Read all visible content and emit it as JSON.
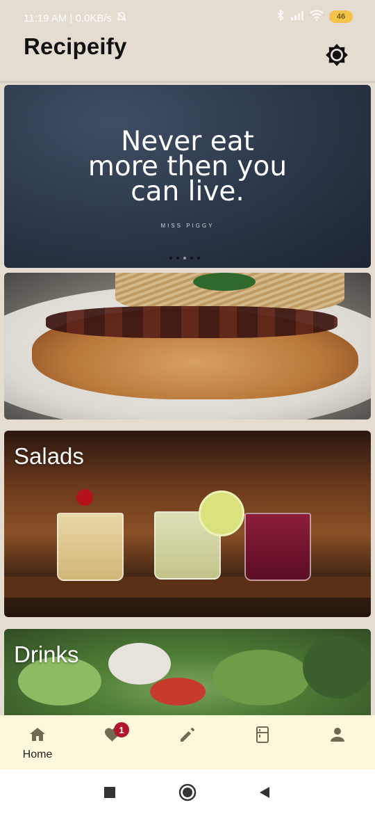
{
  "status_bar": {
    "time_speed": "11:19 AM | 0.0KB/s",
    "battery": "46"
  },
  "app_bar": {
    "title": "Recipeify",
    "settings_icon": "brightness-icon"
  },
  "carousel": {
    "quote_line1": "Never eat",
    "quote_line2": "more then you",
    "quote_line3": "can live.",
    "quote_author": "MISS PIGGY",
    "dot_count": 5,
    "active_dot": 2
  },
  "categories": [
    {
      "label": ""
    },
    {
      "label": "Salads"
    },
    {
      "label": "Drinks"
    }
  ],
  "bottom_nav": {
    "items": [
      {
        "icon": "home-icon",
        "label": "Home"
      },
      {
        "icon": "heart-icon",
        "label": "",
        "badge": "1"
      },
      {
        "icon": "pencil-icon",
        "label": ""
      },
      {
        "icon": "fridge-icon",
        "label": ""
      },
      {
        "icon": "person-icon",
        "label": ""
      }
    ]
  },
  "colors": {
    "background": "#e4dbd1",
    "nav_background": "#fdf8dc",
    "badge": "#b0162b",
    "battery": "#f3c24a"
  }
}
